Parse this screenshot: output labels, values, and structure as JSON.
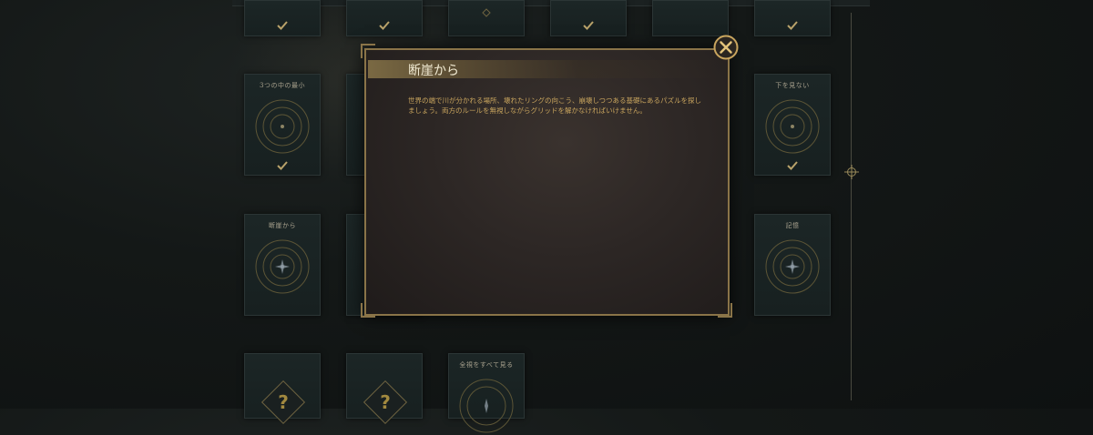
{
  "modal": {
    "title": "断崖から",
    "description": "世界の端で川が分かれる場所、壊れたリングの向こう、崩壊しつつある基礎にあるパズルを探しましょう。両方のルールを無視しながらグリッドを解かなければいけません。",
    "close_icon": "close-x-icon"
  },
  "cards": {
    "three_minimum": {
      "title": "3つの中の最小",
      "icon": "concentric-rings-icon",
      "status": "completed"
    },
    "cliff": {
      "title": "断崖から",
      "icon": "compass-rings-icon"
    },
    "dont_look_down": {
      "title": "下を見ない",
      "icon": "concentric-rings-icon",
      "status": "completed"
    },
    "memory": {
      "title": "記憶",
      "icon": "compass-rings-icon"
    },
    "see_everything": {
      "title": "全視をすべて見る",
      "icon": "compass-rings-icon"
    },
    "locked_1": {
      "title": "",
      "icon": "question-mark-icon"
    },
    "locked_2": {
      "title": "",
      "icon": "question-mark-icon"
    }
  },
  "colors": {
    "gold_accent": "#8a7448",
    "body_text": "#c9a55e",
    "title_text": "#f1ead2",
    "card_bg": "#1c2626"
  }
}
